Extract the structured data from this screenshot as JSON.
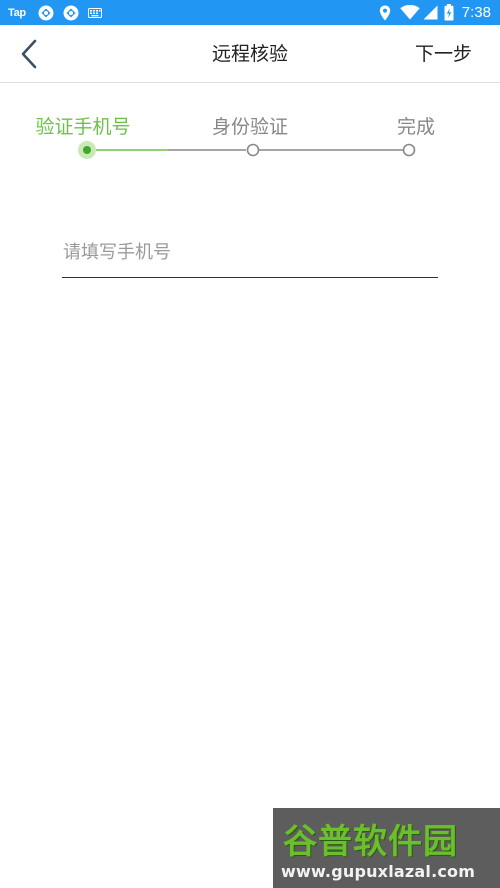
{
  "status_bar": {
    "carrier_text": "Tap",
    "time": "7:38",
    "background": "#2196f3",
    "icons": [
      "sync-icon",
      "sync-icon",
      "keyboard-icon",
      "location-icon",
      "wifi-icon",
      "signal-icon",
      "battery-icon"
    ]
  },
  "header": {
    "back_icon": "chevron-left-icon",
    "title": "远程核验",
    "next_label": "下一步"
  },
  "stepper": {
    "steps": [
      {
        "label": "验证手机号",
        "state": "active"
      },
      {
        "label": "身份验证",
        "state": "pending"
      },
      {
        "label": "完成",
        "state": "pending"
      }
    ],
    "active_color": "#6cc24a",
    "inactive_color": "#888888"
  },
  "phone_input": {
    "value": "",
    "placeholder": "请填写手机号"
  },
  "watermark": {
    "logo_text": "谷普软件园",
    "url": "www.gupuxlazal.com"
  }
}
